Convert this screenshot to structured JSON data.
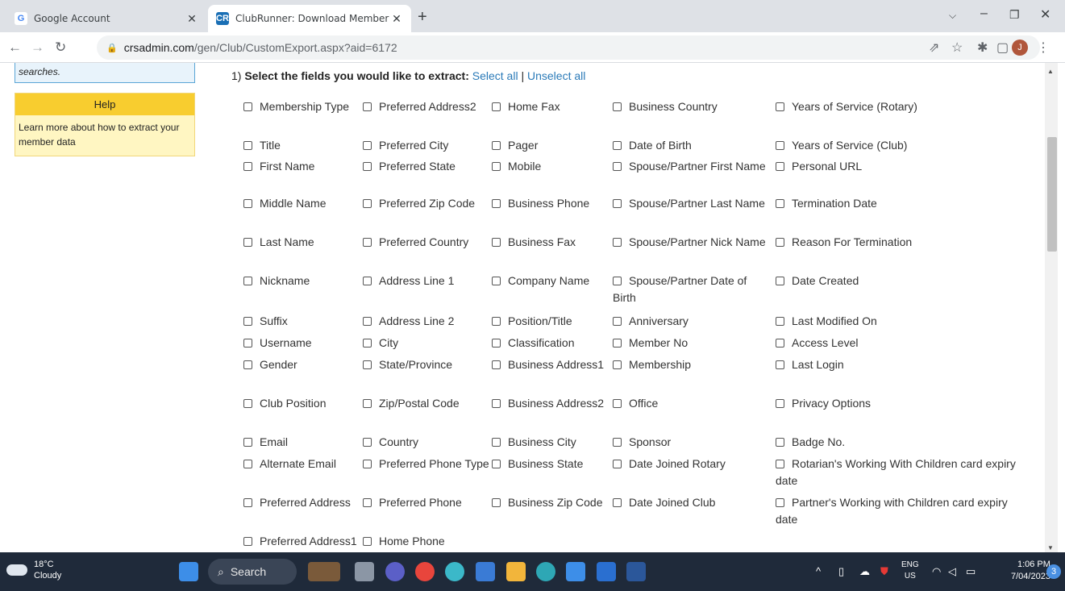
{
  "browser": {
    "tabs": [
      {
        "title": "Google Account",
        "favicon": "G"
      },
      {
        "title": "ClubRunner: Download Member",
        "favicon": "CR"
      }
    ],
    "url_host": "crsadmin.com",
    "url_path": "/gen/Club/CustomExport.aspx?aid=6172",
    "avatar_letter": "J"
  },
  "sidebar": {
    "search_hint": "searches.",
    "help_title": "Help",
    "help_text": "Learn more about how to extract your member data"
  },
  "main": {
    "heading_prefix": "1) ",
    "heading": "Select the fields you would like to extract:",
    "select_all": "Select all",
    "separator": "|",
    "unselect_all": "Unselect all",
    "fields": [
      [
        "Membership Type",
        "Preferred Address2",
        "Home Fax",
        "Business Country",
        "Years of Service (Rotary)"
      ],
      [
        "Title",
        "Preferred City",
        "Pager",
        "Date of Birth",
        "Years of Service (Club)"
      ],
      [
        "First Name",
        "Preferred State",
        "Mobile",
        "Spouse/Partner First Name",
        "Personal URL"
      ],
      [
        "Middle Name",
        "Preferred Zip Code",
        "Business Phone",
        "Spouse/Partner Last Name",
        "Termination Date"
      ],
      [
        "Last Name",
        "Preferred Country",
        "Business Fax",
        "Spouse/Partner Nick Name",
        "Reason For Termination"
      ],
      [
        "Nickname",
        "Address Line 1",
        "Company Name",
        "Spouse/Partner Date of Birth",
        "Date Created"
      ],
      [
        "Suffix",
        "Address Line 2",
        "Position/Title",
        "Anniversary",
        "Last Modified On"
      ],
      [
        "Username",
        "City",
        "Classification",
        "Member No",
        "Access Level"
      ],
      [
        "Gender",
        "State/Province",
        "Business Address1",
        "Membership",
        "Last Login"
      ],
      [
        "Club Position",
        "Zip/Postal Code",
        "Business Address2",
        "Office",
        "Privacy Options"
      ],
      [
        "Email",
        "Country",
        "Business City",
        "Sponsor",
        "Badge No."
      ],
      [
        "Alternate Email",
        "Preferred Phone Type",
        "Business State",
        "Date Joined Rotary",
        "Rotarian's Working With Children card expiry date"
      ],
      [
        "Preferred Address",
        "Preferred Phone",
        "Business Zip Code",
        "Date Joined Club",
        "Partner's Working with Children card expiry date"
      ],
      [
        "Preferred Address1",
        "Home Phone",
        "",
        "",
        ""
      ]
    ]
  },
  "taskbar": {
    "temp": "18°C",
    "weather": "Cloudy",
    "search_label": "Search",
    "lang": "ENG",
    "region": "US",
    "time": "1:06 PM",
    "date": "7/04/2023",
    "notif_count": "3"
  }
}
